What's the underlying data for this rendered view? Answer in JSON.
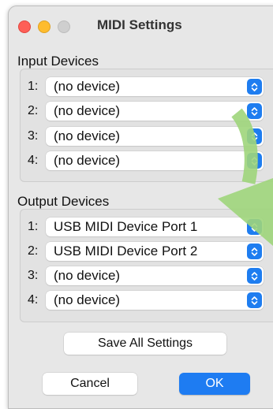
{
  "window": {
    "title": "MIDI Settings"
  },
  "input": {
    "label": "Input Devices",
    "rows": [
      {
        "num": "1:",
        "value": "(no device)"
      },
      {
        "num": "2:",
        "value": "(no device)"
      },
      {
        "num": "3:",
        "value": "(no device)"
      },
      {
        "num": "4:",
        "value": "(no device)"
      }
    ]
  },
  "output": {
    "label": "Output Devices",
    "rows": [
      {
        "num": "1:",
        "value": "USB MIDI Device Port 1"
      },
      {
        "num": "2:",
        "value": "USB MIDI Device Port 2"
      },
      {
        "num": "3:",
        "value": "(no device)"
      },
      {
        "num": "4:",
        "value": "(no device)"
      }
    ]
  },
  "buttons": {
    "save_all": "Save All Settings",
    "cancel": "Cancel",
    "ok": "OK"
  },
  "colors": {
    "accent": "#1e7cf2",
    "close": "#fe5f57",
    "minimize": "#febc2e",
    "annotation_arrow": "#9fd57b"
  },
  "icons": {
    "stepper": "chevron-up-down-icon",
    "annotation": "arrow-down-icon"
  }
}
